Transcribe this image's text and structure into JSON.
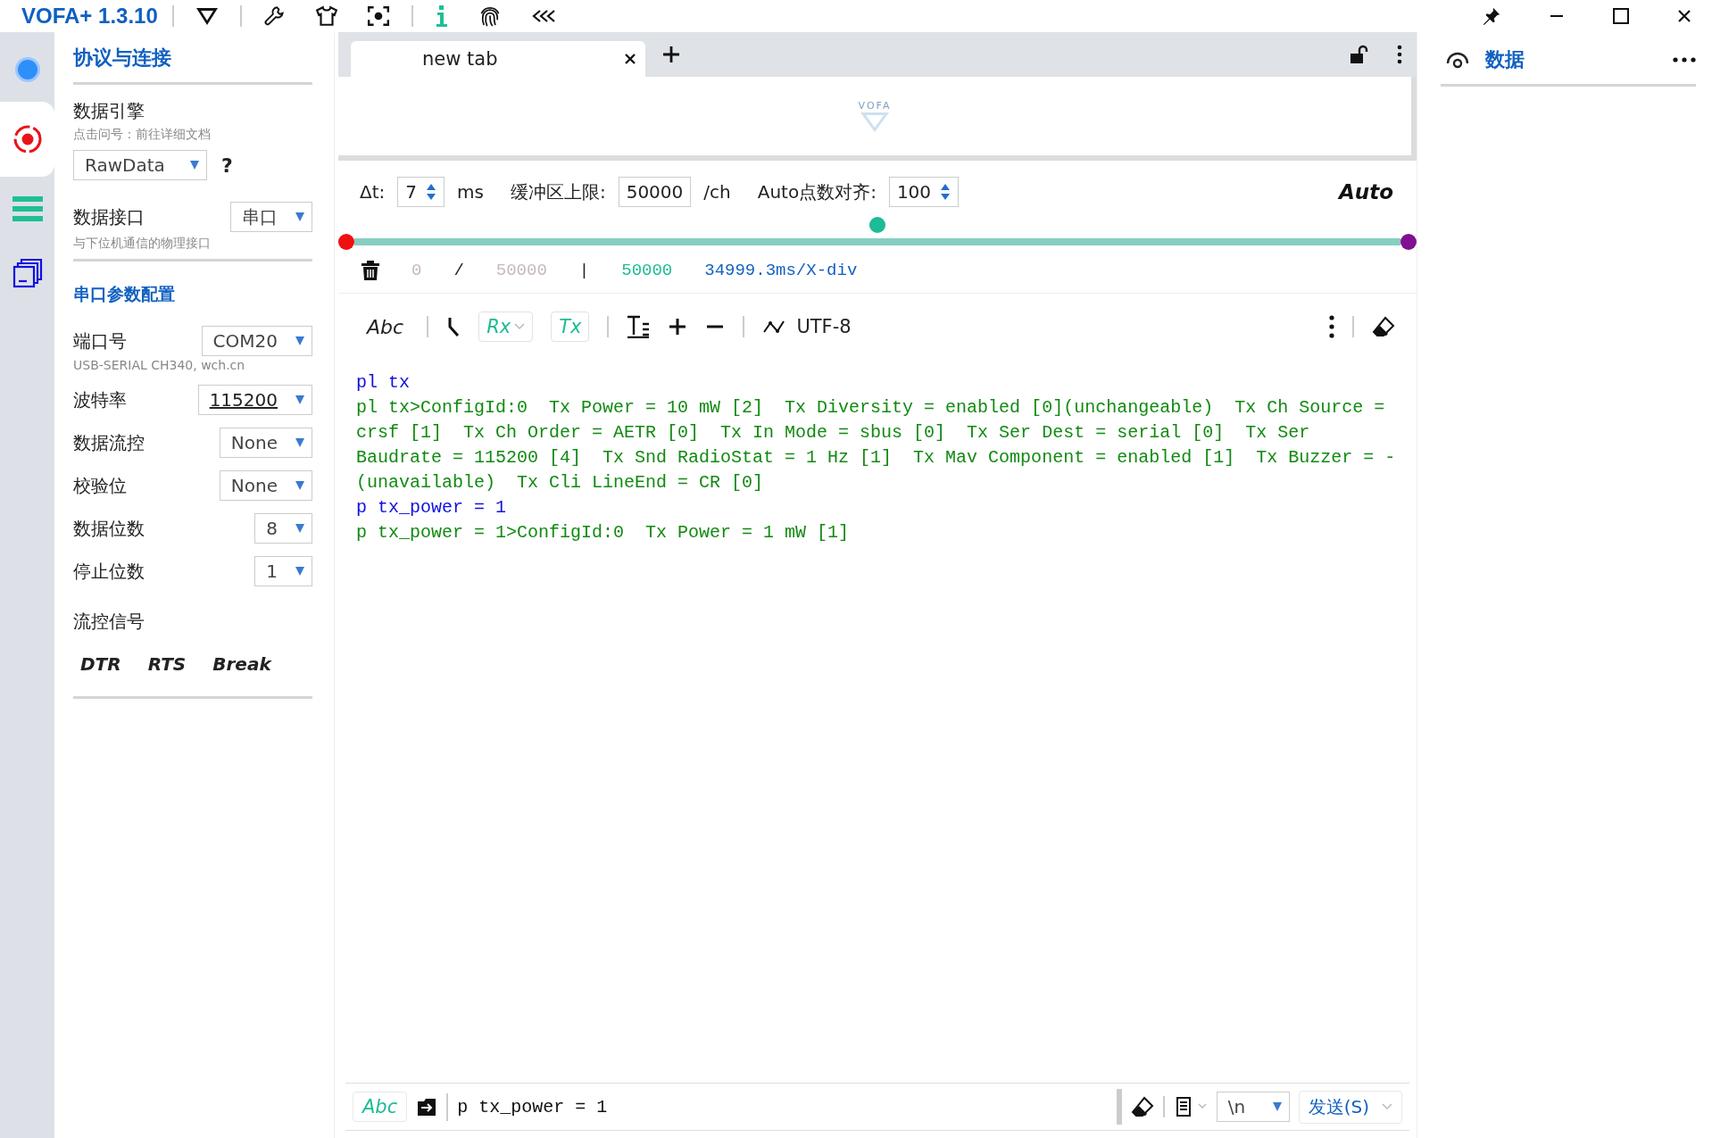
{
  "app": {
    "title": "VOFA+ 1.3.10"
  },
  "rail": [
    {
      "selected": false
    },
    {
      "selected": true
    },
    {
      "selected": false
    },
    {
      "selected": false
    }
  ],
  "left_panel": {
    "title": "协议与连接",
    "data_engine": {
      "label": "数据引擎",
      "hint": "点击问号：前往详细文档",
      "value": "RawData",
      "help": "?"
    },
    "data_interface": {
      "label": "数据接口",
      "value": "串口",
      "hint": "与下位机通信的物理接口"
    },
    "serial_config": {
      "title": "串口参数配置",
      "fields": [
        {
          "label": "端口号",
          "value": "COM20",
          "hint": "USB-SERIAL CH340, wch.cn",
          "focused": false
        },
        {
          "label": "波特率",
          "value": "115200",
          "focused": true
        },
        {
          "label": "数据流控",
          "value": "None",
          "focused": false
        },
        {
          "label": "校验位",
          "value": "None",
          "focused": false
        },
        {
          "label": "数据位数",
          "value": "8",
          "focused": false
        },
        {
          "label": "停止位数",
          "value": "1",
          "focused": false
        }
      ]
    },
    "flow_signals": {
      "label": "流控信号",
      "buttons": [
        "DTR",
        "RTS",
        "Break"
      ]
    }
  },
  "tabs": [
    {
      "label": "new tab",
      "selected": true
    }
  ],
  "logo_text": "VOFA",
  "controls": {
    "dt_label": "Δt:",
    "dt_value": "7",
    "dt_unit": "ms",
    "buffer_label": "缓冲区上限:",
    "buffer_value": "50000",
    "buffer_unit": "/ch",
    "align_label": "Auto点数对齐:",
    "align_value": "100",
    "auto": "Auto"
  },
  "slider": {
    "level": 0.5
  },
  "stats": {
    "count": "0",
    "sep": "/",
    "limit": "50000",
    "bar": "|",
    "buffer": "50000",
    "xdiv": "34999.3ms/X-div"
  },
  "toolbar": {
    "format": "Abc",
    "rx": "Rx",
    "tx": "Tx",
    "encoding": "UTF-8"
  },
  "log": [
    {
      "kind": "tx",
      "text": "pl tx"
    },
    {
      "kind": "rx",
      "text": "pl tx>ConfigId:0  Tx Power = 10 mW [2]  Tx Diversity = enabled [0](unchangeable)  Tx Ch Source = crsf [1]  Tx Ch Order = AETR [0]  Tx In Mode = sbus [0]  Tx Ser Dest = serial [0]  Tx Ser Baudrate = 115200 [4]  Tx Snd RadioStat = 1 Hz [1]  Tx Mav Component = enabled [1]  Tx Buzzer = - (unavailable)  Tx Cli LineEnd = CR [0]"
    },
    {
      "kind": "tx",
      "text": "p tx_power = 1"
    },
    {
      "kind": "rx",
      "text": "p tx_power = 1>ConfigId:0  Tx Power = 1 mW [1]"
    }
  ],
  "send_bar": {
    "format": "Abc",
    "value": "p tx_power = 1",
    "line_end": "\\n",
    "send": "发送(S)"
  },
  "right_panel": {
    "title": "数据"
  }
}
